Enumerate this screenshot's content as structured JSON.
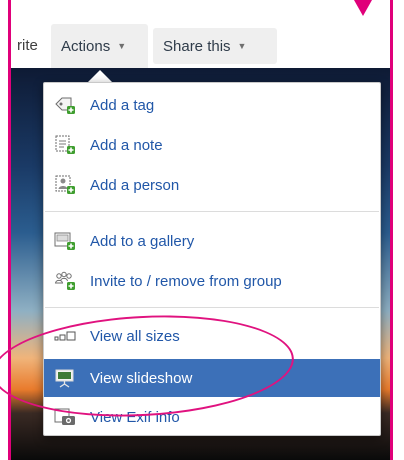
{
  "toolbar": {
    "favorite_partial": "rite",
    "actions_label": "Actions",
    "share_label": "Share this"
  },
  "menu": {
    "items": [
      {
        "label": "Add a tag",
        "icon": "tag-add-icon"
      },
      {
        "label": "Add a note",
        "icon": "note-add-icon"
      },
      {
        "label": "Add a person",
        "icon": "person-add-icon"
      },
      {
        "label": "Add to a gallery",
        "icon": "gallery-add-icon"
      },
      {
        "label": "Invite to / remove from group",
        "icon": "group-icon"
      },
      {
        "label": "View all sizes",
        "icon": "sizes-icon"
      },
      {
        "label": "View slideshow",
        "icon": "slideshow-icon",
        "selected": true
      },
      {
        "label": "View Exif info",
        "icon": "camera-icon"
      }
    ]
  },
  "colors": {
    "annotation": "#e0127f",
    "link": "#2157a8",
    "selected_bg": "#3c70b8"
  }
}
